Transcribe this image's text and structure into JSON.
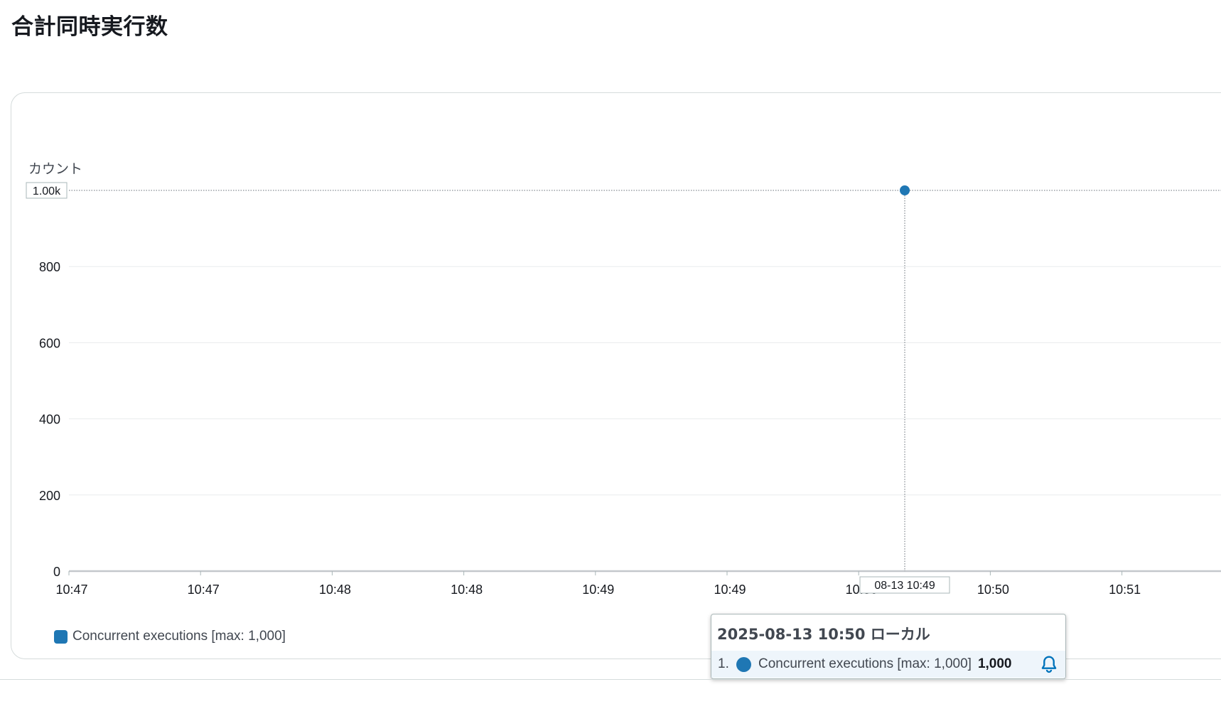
{
  "page": {
    "title": "合計同時実行数"
  },
  "chart_data": {
    "type": "line",
    "y_unit_label": "カウント",
    "ylim": [
      0,
      1000
    ],
    "y_ticks": [
      0,
      200,
      400,
      600,
      800
    ],
    "y_max_label": "1.00k",
    "x_tick_labels": [
      "10:47",
      "10:47",
      "10:48",
      "10:48",
      "10:49",
      "10:49",
      "10:50",
      "10:50",
      "10:51"
    ],
    "grid": true,
    "legend_position": "bottom-left",
    "series": [
      {
        "name": "Concurrent executions [max: 1,000]",
        "color": "#1f77b4",
        "points": [
          {
            "x": "2025-08-13 10:50",
            "y": 1000
          }
        ]
      }
    ],
    "crosshair_label": "08-13 10:49",
    "tooltip": {
      "header": "2025-08-13 10:50 ローカル",
      "rows": [
        {
          "index": "1.",
          "series": "Concurrent executions [max: 1,000]",
          "value": "1,000"
        }
      ]
    }
  },
  "icons": {
    "tooltip_alarm": "bell-icon"
  }
}
